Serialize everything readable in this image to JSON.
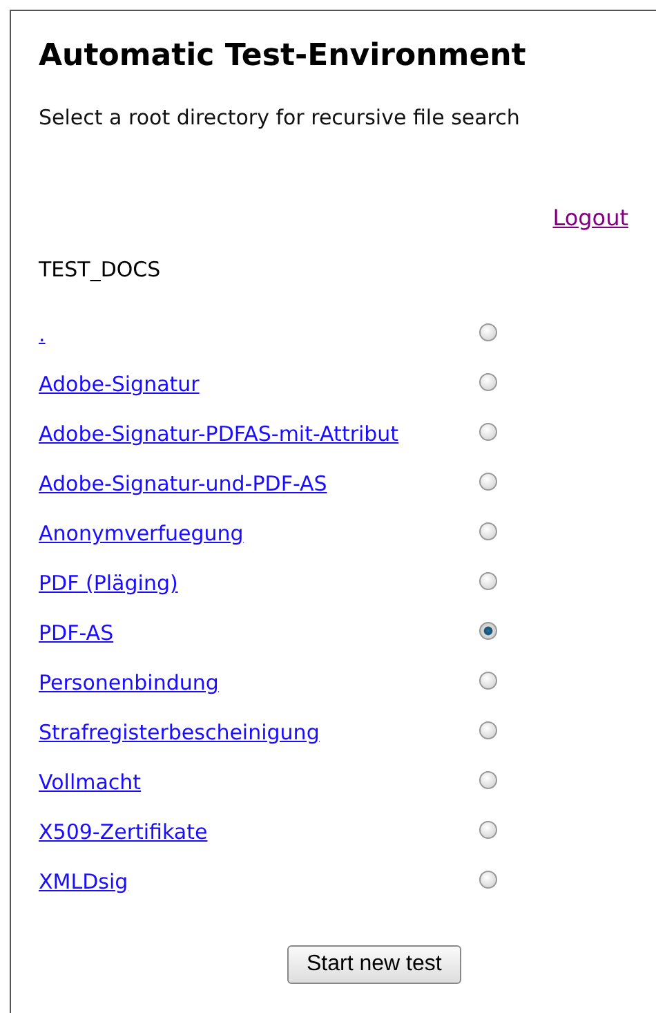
{
  "title": "Automatic Test-Environment",
  "subtitle": "Select a root directory for recursive file search",
  "logout": "Logout",
  "root": "TEST_DOCS",
  "directories": [
    {
      "label": ".",
      "selected": false
    },
    {
      "label": "Adobe-Signatur",
      "selected": false
    },
    {
      "label": "Adobe-Signatur-PDFAS-mit-Attribut",
      "selected": false
    },
    {
      "label": "Adobe-Signatur-und-PDF-AS",
      "selected": false
    },
    {
      "label": "Anonymverfuegung",
      "selected": false
    },
    {
      "label": "PDF (Pläging)",
      "selected": false
    },
    {
      "label": "PDF-AS",
      "selected": true
    },
    {
      "label": "Personenbindung",
      "selected": false
    },
    {
      "label": "Strafregisterbescheinigung",
      "selected": false
    },
    {
      "label": "Vollmacht",
      "selected": false
    },
    {
      "label": "X509-Zertifikate",
      "selected": false
    },
    {
      "label": "XMLDsig",
      "selected": false
    }
  ],
  "button": "Start new test"
}
